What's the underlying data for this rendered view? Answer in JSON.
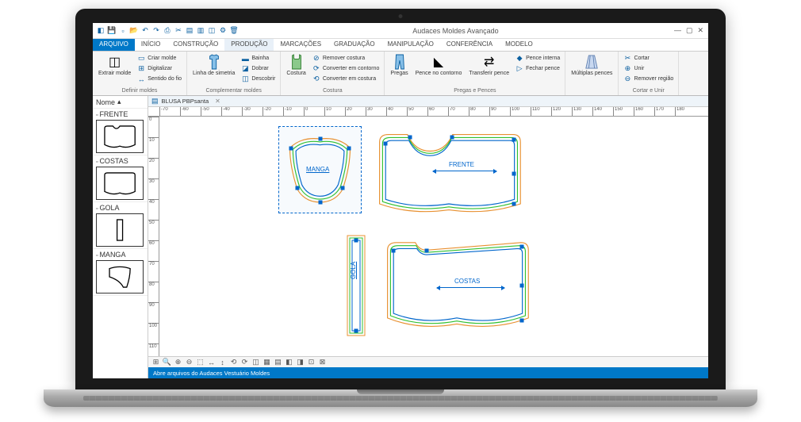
{
  "title": "Audaces Moldes Avançado",
  "tabs": [
    "ARQUIVO",
    "INÍCIO",
    "CONSTRUÇÃO",
    "PRODUÇÃO",
    "MARCAÇÕES",
    "GRADUAÇÃO",
    "MANIPULAÇÃO",
    "CONFERÊNCIA",
    "MODELO"
  ],
  "active_tab": 3,
  "ribbon": {
    "g0": {
      "title": "Definir moldes",
      "big": "Extrair molde",
      "items": [
        "Criar molde",
        "Digitalizar",
        "Sentido do fio"
      ]
    },
    "g1": {
      "title": "Complementar moldes",
      "big": "Linha de simetria",
      "items": [
        "Bainha",
        "Dobrar",
        "Descobrir"
      ]
    },
    "g2": {
      "title": "Costura",
      "big": "Costura",
      "items": [
        "Remover costura",
        "Converter em contorno",
        "Converter em costura"
      ]
    },
    "g3": {
      "title": "Pregas e Pences",
      "b0": "Pregas",
      "b1": "Pence no contorno",
      "b2": "Transferir pence",
      "items": [
        "Pence interna",
        "Fechar pence"
      ]
    },
    "g4": {
      "title": "",
      "big": "Múltiplas pences"
    },
    "g5": {
      "title": "Cortar e Unir",
      "items": [
        "Cortar",
        "Unir",
        "Remover região"
      ]
    }
  },
  "doc_tab": "BLUSA PBPsanta",
  "side_head": "Nome",
  "side_items": [
    "FRENTE",
    "COSTAS",
    "GOLA",
    "MANGA"
  ],
  "pieces": {
    "manga": "MANGA",
    "frente": "FRENTE",
    "gola": "GOLA",
    "costas": "COSTAS"
  },
  "ruler_h": [
    "-70",
    "-60",
    "-50",
    "-40",
    "-30",
    "-20",
    "-10",
    "0",
    "10",
    "20",
    "30",
    "40",
    "50",
    "60",
    "70",
    "80",
    "90",
    "100",
    "110",
    "120",
    "130",
    "140",
    "150",
    "160",
    "170",
    "180"
  ],
  "ruler_v": [
    "0",
    "10",
    "20",
    "30",
    "40",
    "50",
    "60",
    "70",
    "80",
    "90",
    "100",
    "110"
  ],
  "status": "Abre arquivos do Audaces Vestuário Moldes"
}
